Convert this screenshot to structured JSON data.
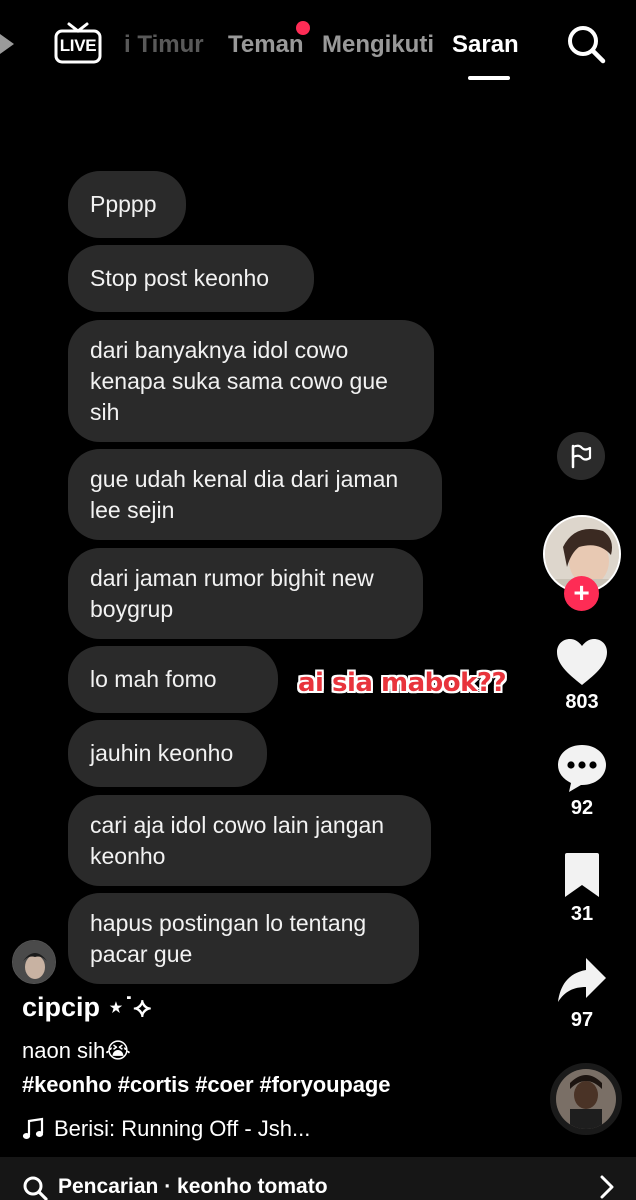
{
  "nav": {
    "live_label": "LIVE",
    "tabs": [
      {
        "label": "i Timur",
        "active": false
      },
      {
        "label": "Teman",
        "active": false,
        "has_notification": true
      },
      {
        "label": "Mengikuti",
        "active": false
      },
      {
        "label": "Saran",
        "active": true
      }
    ],
    "search_icon": "search-icon",
    "notification_color": "#fe2c55"
  },
  "chat": {
    "messages": [
      "Ppppp",
      "Stop post keonho",
      "dari banyaknya idol cowo kenapa suka sama cowo gue sih",
      "gue udah kenal dia dari jaman lee sejin",
      "dari jaman rumor bighit new boygrup",
      "lo mah fomo",
      "jauhin keonho",
      "cari aja idol cowo lain jangan keonho",
      "hapus postingan lo tentang pacar gue"
    ],
    "overlay_text": "ai sia mabok??"
  },
  "rail": {
    "likes": "803",
    "comments": "92",
    "saves": "31",
    "shares": "97",
    "follow_symbol": "+"
  },
  "post": {
    "username": "cipcip ⋆˙⟡",
    "caption": "naon sih😭",
    "hashtags": "#keonho #cortis #coer #foryoupage",
    "sound": "Berisi: Running Off - Jsh..."
  },
  "search_bar": {
    "text": "Pencarian · keonho tomato"
  },
  "colors": {
    "accent": "#fe2c55",
    "bubble": "#2a2a2a",
    "background": "#000000"
  }
}
